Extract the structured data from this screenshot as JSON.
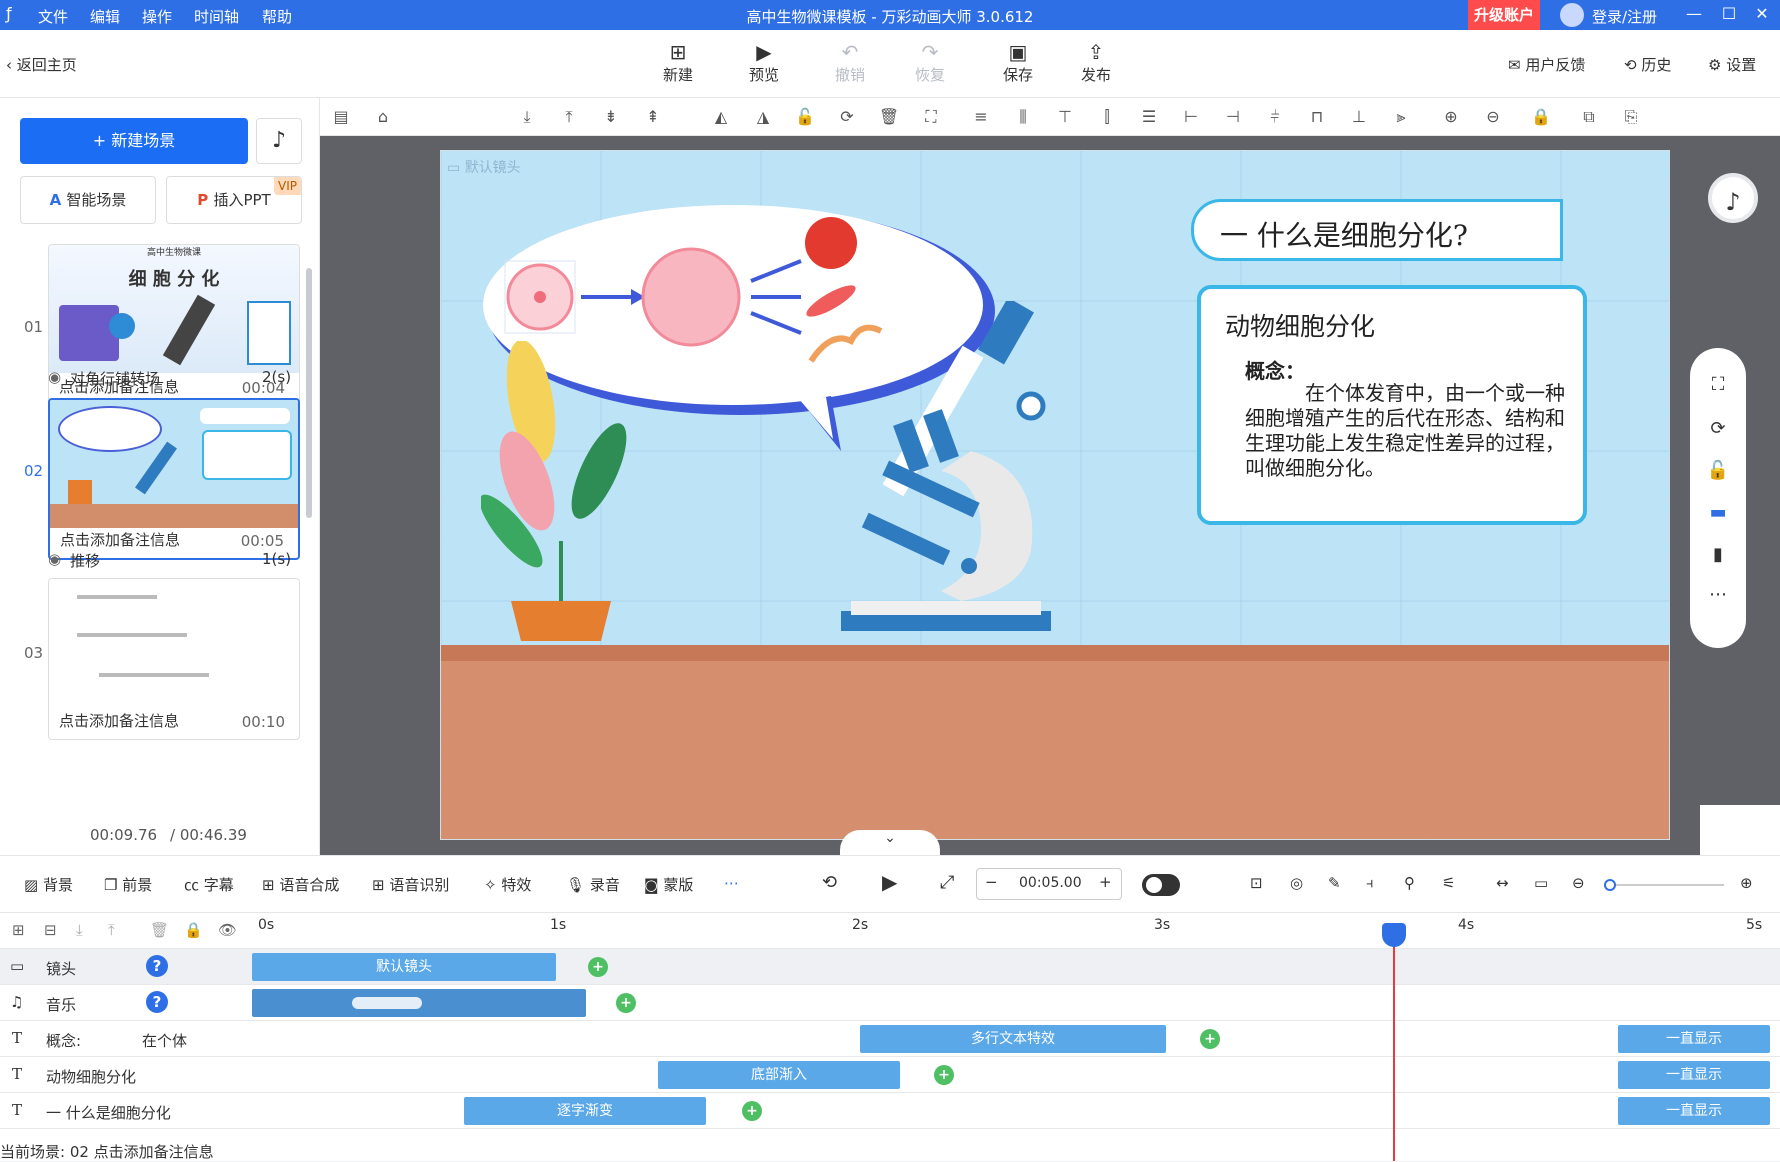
{
  "titlebar": {
    "menus": [
      "文件",
      "编辑",
      "操作",
      "时间轴",
      "帮助"
    ],
    "title": "高中生物微课模板 - 万彩动画大师 3.0.612",
    "upgrade": "升级账户",
    "login": "登录/注册"
  },
  "toolbar": {
    "back": "返回主页",
    "buttons": [
      {
        "label": "新建",
        "icon": "plus-square-icon"
      },
      {
        "label": "预览",
        "icon": "play-icon"
      },
      {
        "label": "撤销",
        "icon": "undo-icon"
      },
      {
        "label": "恢复",
        "icon": "redo-icon"
      },
      {
        "label": "保存",
        "icon": "save-icon"
      },
      {
        "label": "发布",
        "icon": "publish-icon"
      }
    ],
    "feedback": "用户反馈",
    "history": "历史",
    "settings": "设置"
  },
  "left": {
    "new_scene": "+ 新建场景",
    "smart_scene": "智能场景",
    "insert_ppt": "插入PPT",
    "vip": "VIP",
    "scenes": [
      {
        "num": "01",
        "note": "点击添加备注信息",
        "dur": "00:04"
      },
      {
        "num": "02",
        "note": "点击添加备注信息",
        "dur": "00:05"
      },
      {
        "num": "03",
        "note": "点击添加备注信息",
        "dur": "00:10"
      }
    ],
    "transitions": [
      {
        "name": "对角行铺转场",
        "dur": "2(s)"
      },
      {
        "name": "推移",
        "dur": "1(s)"
      }
    ],
    "thumb1_title_small": "高中生物微课",
    "thumb1_title": "细 胞 分 化",
    "time_current": "00:09.76",
    "time_total": "/ 00:46.39"
  },
  "stage": {
    "camera_label": "默认镜头",
    "heading": "一  什么是细胞分化?",
    "card_title": "动物细胞分化",
    "concept_label": "概念：",
    "concept_text": "在个体发育中，由一个或一种细胞增殖产生的后代在形态、结构和生理功能上发生稳定性差异的过程，叫做细胞分化。"
  },
  "timeline_tools": {
    "items": [
      "背景",
      "前景",
      "字幕",
      "语音合成",
      "语音识别",
      "特效",
      "录音",
      "蒙版"
    ],
    "duration": "00:05.00"
  },
  "timeline": {
    "ticks": [
      "0s",
      "1s",
      "2s",
      "3s",
      "4s",
      "5s"
    ],
    "tracks": [
      {
        "icon": "camera-icon",
        "name": "镜头",
        "extra": "",
        "clips": [
          {
            "label": "默认镜头"
          }
        ]
      },
      {
        "icon": "music-note-icon",
        "name": "音乐",
        "extra": "",
        "clips": [
          {
            "label": ""
          }
        ]
      },
      {
        "icon": "text-icon",
        "name": "概念:",
        "extra": "在个体",
        "clips": [
          {
            "label": "多行文本特效"
          },
          {
            "label": "一直显示"
          }
        ]
      },
      {
        "icon": "text-icon",
        "name": "动物细胞分化",
        "extra": "",
        "clips": [
          {
            "label": "底部渐入"
          },
          {
            "label": "一直显示"
          }
        ]
      },
      {
        "icon": "text-icon",
        "name": "一 什么是细胞分化",
        "extra": "",
        "clips": [
          {
            "label": "逐字渐变"
          },
          {
            "label": "一直显示"
          }
        ]
      }
    ],
    "status": "当前场景: 02   点击添加备注信息"
  }
}
